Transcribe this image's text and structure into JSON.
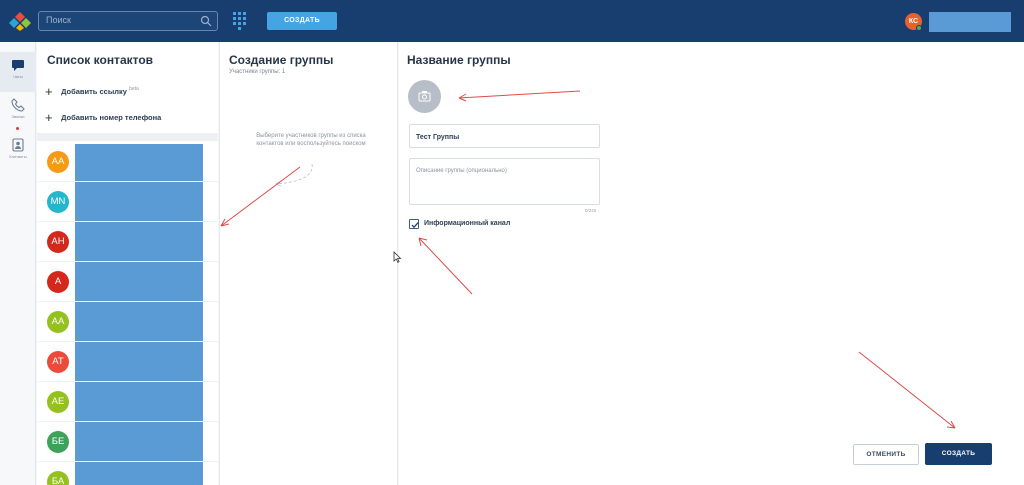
{
  "header": {
    "search_placeholder": "Поиск",
    "create_button": "СОЗДАТЬ",
    "user_initials": "КС"
  },
  "rail": {
    "items": [
      {
        "label": "Чаты",
        "icon": "chat-icon",
        "active": true
      },
      {
        "label": "Звонки",
        "icon": "phone-icon"
      },
      {
        "label": "Контакты",
        "icon": "contacts-icon"
      }
    ]
  },
  "contacts": {
    "title": "Список контактов",
    "add_link": "Добавить ссылку",
    "add_link_badge": "beta",
    "add_phone": "Добавить номер телефона",
    "avatars": [
      {
        "initials": "АА",
        "color": "#f59a17"
      },
      {
        "initials": "MN",
        "color": "#24b6cc"
      },
      {
        "initials": "АН",
        "color": "#d4281d"
      },
      {
        "initials": "А",
        "color": "#d4281d"
      },
      {
        "initials": "АА",
        "color": "#94c11f"
      },
      {
        "initials": "АТ",
        "color": "#ea4b3b"
      },
      {
        "initials": "АЕ",
        "color": "#94c11f"
      },
      {
        "initials": "БЕ",
        "color": "#3ea35a"
      },
      {
        "initials": "БА",
        "color": "#94c11f"
      }
    ]
  },
  "create_group": {
    "title": "Создание группы",
    "members_label": "Участники группы: 1",
    "hint": "Выберите участников группы из списка контактов или воспользуйтесь поиском"
  },
  "group_name": {
    "title": "Название группы",
    "name_value": "Тест Группы",
    "description_placeholder": "Описание группы (опционально)",
    "counter": "0/220",
    "channel_checkbox_label": "Информационный канал",
    "channel_checked": true,
    "cancel_button": "ОТМЕНИТЬ",
    "create_button": "СОЗДАТЬ"
  }
}
